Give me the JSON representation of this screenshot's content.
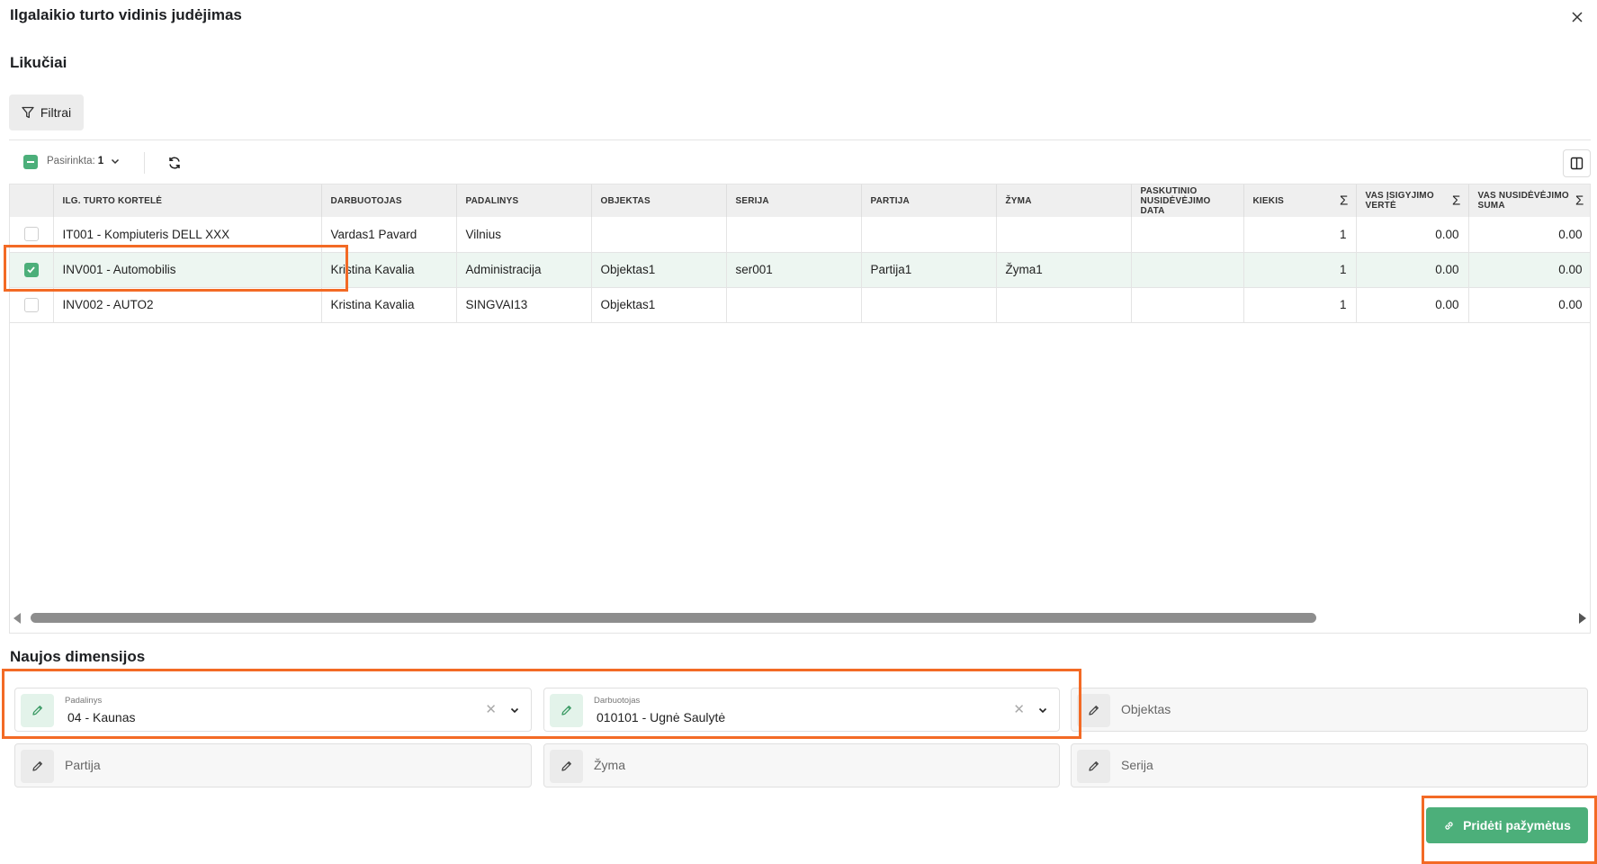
{
  "dialog": {
    "title": "Ilgalaikio turto vidinis judėjimas"
  },
  "section_balances": {
    "title": "Likučiai"
  },
  "toolbar": {
    "filter_label": "Filtrai",
    "selected_label": "Pasirinkta:",
    "selected_count": "1"
  },
  "table": {
    "columns": [
      {
        "label": "Ilg. turto kortelė",
        "sum": false
      },
      {
        "label": "Darbuotojas",
        "sum": false
      },
      {
        "label": "Padalinys",
        "sum": false
      },
      {
        "label": "Objektas",
        "sum": false
      },
      {
        "label": "Serija",
        "sum": false
      },
      {
        "label": "Partija",
        "sum": false
      },
      {
        "label": "Žyma",
        "sum": false
      },
      {
        "label": "Paskutinio nusidėvėjimo data",
        "sum": false
      },
      {
        "label": "Kiekis",
        "sum": true
      },
      {
        "label": "VAS įsigyjimo vertė",
        "sum": true
      },
      {
        "label": "VAS nusidėvėjimo suma",
        "sum": true
      }
    ],
    "rows": [
      {
        "checked": false,
        "cells": [
          "IT001 - Kompiuteris DELL XXX",
          "Vardas1 Pavard",
          "Vilnius",
          "",
          "",
          "",
          "",
          "",
          "1",
          "0.00",
          "0.00"
        ]
      },
      {
        "checked": true,
        "cells": [
          "INV001 - Automobilis",
          "Kristina Kavalia",
          "Administracija",
          "Objektas1",
          "ser001",
          "Partija1",
          "Žyma1",
          "",
          "1",
          "0.00",
          "0.00"
        ]
      },
      {
        "checked": false,
        "cells": [
          "INV002 - AUTO2",
          "Kristina Kavalia",
          "SINGVAI13",
          "Objektas1",
          "",
          "",
          "",
          "",
          "1",
          "0.00",
          "0.00"
        ]
      }
    ]
  },
  "section_dimensions": {
    "title": "Naujos dimensijos"
  },
  "dimensions": {
    "padalinys": {
      "label": "Padalinys",
      "value": "04 - Kaunas"
    },
    "darbuotojas": {
      "label": "Darbuotojas",
      "value": "010101 - Ugnė Saulytė"
    },
    "objektas": {
      "placeholder": "Objektas"
    },
    "partija": {
      "placeholder": "Partija"
    },
    "zyma": {
      "placeholder": "Žyma"
    },
    "serija": {
      "placeholder": "Serija"
    }
  },
  "actions": {
    "add_selected_label": "Pridėti pažymėtus"
  },
  "colors": {
    "accent": "#4caf7a",
    "highlight": "#f36a25",
    "selected_row": "#edf6f1"
  }
}
